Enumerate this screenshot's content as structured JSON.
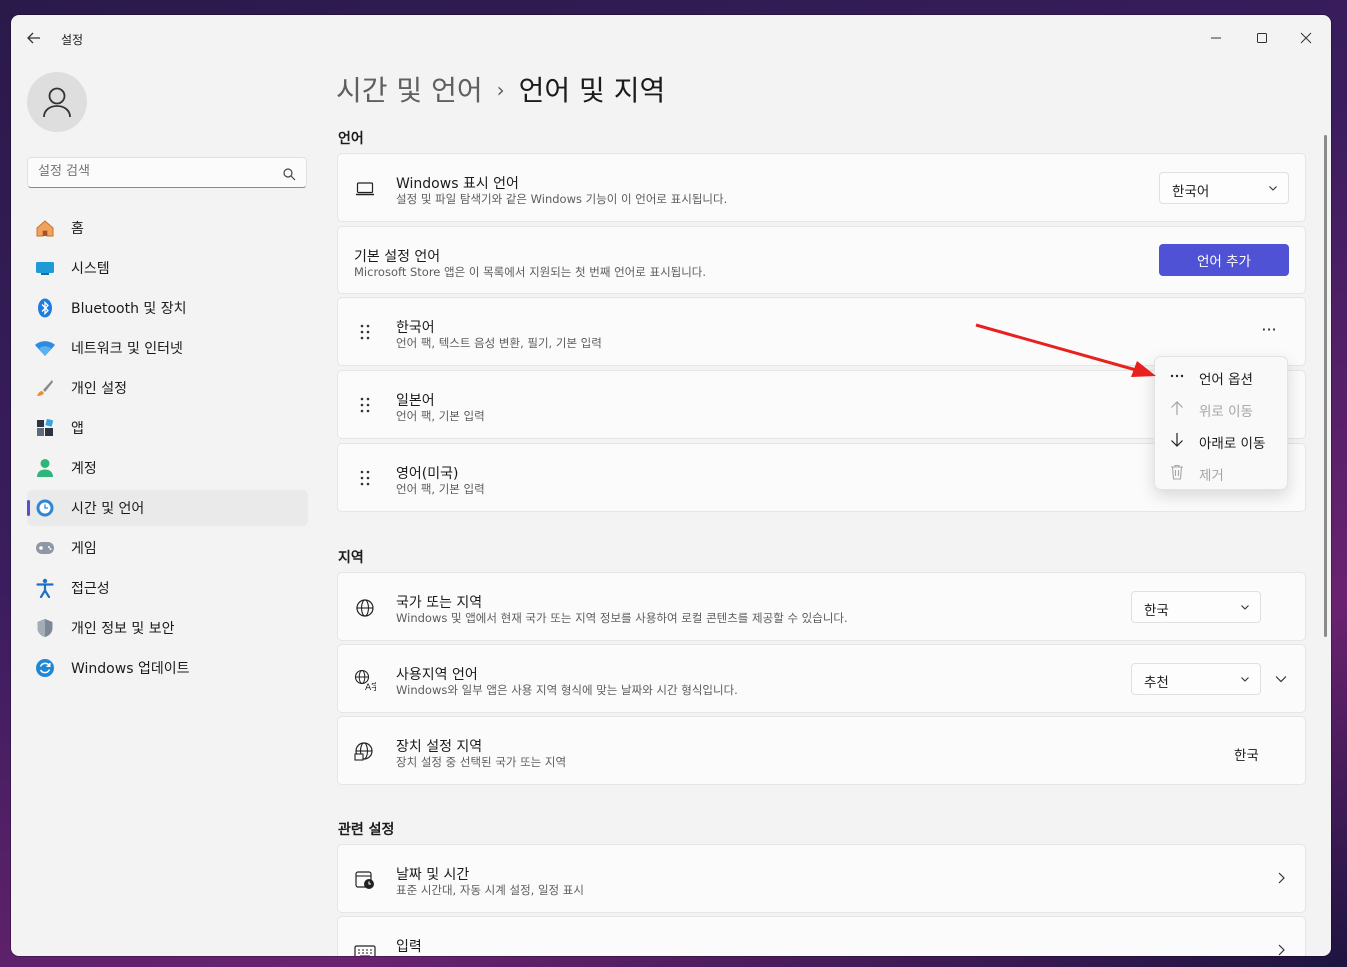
{
  "app": {
    "title": "설정"
  },
  "search": {
    "placeholder": "설정 검색"
  },
  "nav": {
    "items": [
      {
        "label": "홈",
        "icon": "home-icon"
      },
      {
        "label": "시스템",
        "icon": "system-icon"
      },
      {
        "label": "Bluetooth 및 장치",
        "icon": "bluetooth-icon"
      },
      {
        "label": "네트워크 및 인터넷",
        "icon": "wifi-icon"
      },
      {
        "label": "개인 설정",
        "icon": "brush-icon"
      },
      {
        "label": "앱",
        "icon": "apps-icon"
      },
      {
        "label": "계정",
        "icon": "account-icon"
      },
      {
        "label": "시간 및 언어",
        "icon": "time-language-icon"
      },
      {
        "label": "게임",
        "icon": "gamepad-icon"
      },
      {
        "label": "접근성",
        "icon": "accessibility-icon"
      },
      {
        "label": "개인 정보 및 보안",
        "icon": "shield-icon"
      },
      {
        "label": "Windows 업데이트",
        "icon": "update-icon"
      }
    ],
    "active_index": 7
  },
  "breadcrumb": {
    "parent": "시간 및 언어",
    "separator": "›",
    "current": "언어 및 지역"
  },
  "sections": {
    "language": "언어",
    "region": "지역",
    "related": "관련 설정"
  },
  "display_language": {
    "title": "Windows 표시 언어",
    "desc": "설정 및 파일 탐색기와 같은 Windows 기능이 이 언어로 표시됩니다.",
    "value": "한국어"
  },
  "preferred": {
    "title": "기본 설정 언어",
    "desc": "Microsoft Store 앱은 이 목록에서 지원되는 첫 번째 언어로 표시됩니다.",
    "button": "언어 추가"
  },
  "languages": [
    {
      "title": "한국어",
      "desc": "언어 팩, 텍스트 음성 변환, 필기, 기본 입력"
    },
    {
      "title": "일본어",
      "desc": "언어 팩, 기본 입력"
    },
    {
      "title": "영어(미국)",
      "desc": "언어 팩, 기본 입력"
    }
  ],
  "more_label": "···",
  "context_menu": {
    "items": [
      {
        "label": "언어 옵션",
        "icon": "more-icon",
        "enabled": true
      },
      {
        "label": "위로 이동",
        "icon": "arrow-up-icon",
        "enabled": false
      },
      {
        "label": "아래로 이동",
        "icon": "arrow-down-icon",
        "enabled": true
      },
      {
        "label": "제거",
        "icon": "trash-icon",
        "enabled": false
      }
    ]
  },
  "region": {
    "country": {
      "title": "국가 또는 지역",
      "desc": "Windows 및 앱에서 현재 국가 또는 지역 정보를 사용하여 로컬 콘텐츠를 제공할 수 있습니다.",
      "value": "한국"
    },
    "format": {
      "title": "사용지역 언어",
      "desc": "Windows와 일부 앱은 사용 지역 형식에 맞는 날짜와 시간 형식입니다.",
      "value": "추천"
    },
    "device": {
      "title": "장치 설정 지역",
      "desc": "장치 설정 중 선택된 국가 또는 지역",
      "value": "한국"
    }
  },
  "related": {
    "datetime": {
      "title": "날짜 및 시간",
      "desc": "표준 시간대, 자동 시계 설정, 일정 표시"
    },
    "input": {
      "title": "입력"
    }
  },
  "colors": {
    "accent": "#4f52d4",
    "annotation_arrow": "#e8201e"
  }
}
